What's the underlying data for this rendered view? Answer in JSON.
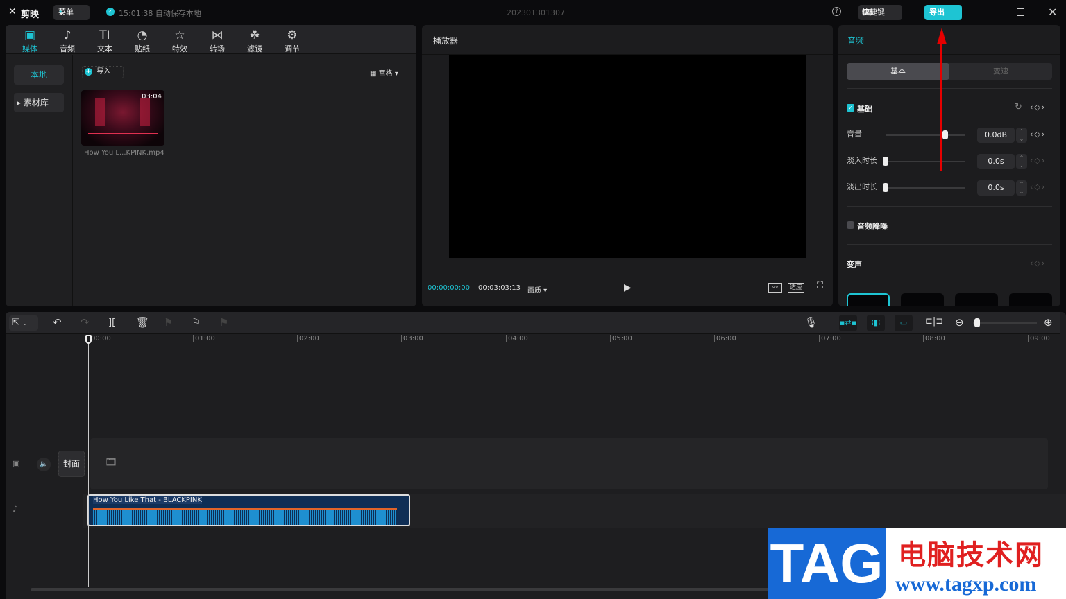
{
  "titlebar": {
    "app_name": "剪映",
    "menu_label": "菜单",
    "autosave": "15:01:38 自动保存本地",
    "project_name": "202301301307",
    "shortcut_label": "快捷键",
    "export_label": "导出"
  },
  "media_panel": {
    "tabs": [
      {
        "label": "媒体",
        "icon": "▣"
      },
      {
        "label": "音频",
        "icon": "♪"
      },
      {
        "label": "文本",
        "icon": "TI"
      },
      {
        "label": "贴纸",
        "icon": "◔"
      },
      {
        "label": "特效",
        "icon": "☆"
      },
      {
        "label": "转场",
        "icon": "⋈"
      },
      {
        "label": "滤镜",
        "icon": "☘"
      },
      {
        "label": "调节",
        "icon": "⚙"
      }
    ],
    "sidebar": [
      "本地",
      "素材库"
    ],
    "import_label": "导入",
    "view_label": "宫格",
    "clip": {
      "duration": "03:04",
      "name": "How You L...KPINK.mp4"
    }
  },
  "player": {
    "title": "播放器",
    "current_time": "00:00:00:00",
    "total_time": "00:03:03:13",
    "quality_label": "画质",
    "fit_label": "适应"
  },
  "audio_panel": {
    "title": "音频",
    "tabs": [
      "基本",
      "变速"
    ],
    "section_basic": "基础",
    "rows": [
      {
        "label": "音量",
        "value": "0.0dB",
        "level": 0.75
      },
      {
        "label": "淡入时长",
        "value": "0.0s",
        "level": 0
      },
      {
        "label": "淡出时长",
        "value": "0.0s",
        "level": 0
      }
    ],
    "denoise_label": "音频降噪",
    "voice_change_label": "变声"
  },
  "timeline": {
    "ruler": [
      "00:00",
      "01:00",
      "02:00",
      "03:00",
      "04:00",
      "05:00",
      "06:00",
      "07:00",
      "08:00",
      "09:00"
    ],
    "cover_label": "封面",
    "audio_clip_name": "How You Like That - BLACKPINK"
  },
  "watermark": {
    "logo": "TAG",
    "site_name": "电脑技术网",
    "url": "www.tagxp.com"
  },
  "colors": {
    "accent": "#1ec4d3",
    "annotation_arrow": "#e60000"
  }
}
